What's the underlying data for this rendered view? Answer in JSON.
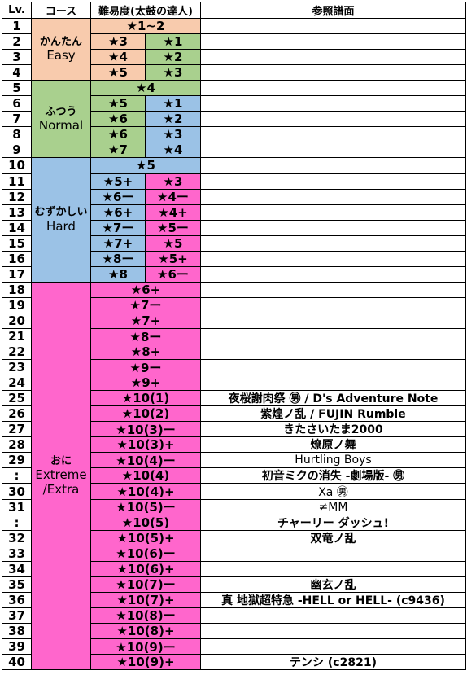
{
  "header": {
    "lv": "Lv.",
    "course": "コース",
    "difficulty": "難易度(太鼓の達人)",
    "reference": "参照譜面"
  },
  "colors": {
    "easy": "#F8CBAD",
    "normal": "#A9D08E",
    "hard": "#9BC2E6",
    "oni": "#FF66CC",
    "white": "#FFFFFF"
  },
  "courses": [
    {
      "jp": "かんたん",
      "en": "Easy",
      "color": "easy"
    },
    {
      "jp": "ふつう",
      "en": "Normal",
      "color": "normal"
    },
    {
      "jp": "むずかしい",
      "en": "Hard",
      "color": "hard"
    },
    {
      "jp": "おに",
      "en": "Extreme\n/Extra",
      "color": "oni"
    }
  ],
  "rows": [
    {
      "lv": "1",
      "full": "★1~2",
      "fc": "easy"
    },
    {
      "lv": "2",
      "left": "★3",
      "lc": "easy",
      "right": "★1",
      "rc": "normal"
    },
    {
      "lv": "3",
      "left": "★4",
      "lc": "easy",
      "right": "★2",
      "rc": "normal"
    },
    {
      "lv": "4",
      "left": "★5",
      "lc": "easy",
      "right": "★3",
      "rc": "normal"
    },
    {
      "lv": "5",
      "full": "★4",
      "fc": "normal"
    },
    {
      "lv": "6",
      "left": "★5",
      "lc": "normal",
      "right": "★1",
      "rc": "hard"
    },
    {
      "lv": "7",
      "left": "★6",
      "lc": "normal",
      "right": "★2",
      "rc": "hard"
    },
    {
      "lv": "8",
      "left": "★6",
      "lc": "normal",
      "right": "★3",
      "rc": "hard"
    },
    {
      "lv": "9",
      "left": "★7",
      "lc": "normal",
      "right": "★4",
      "rc": "hard"
    },
    {
      "lv": "10",
      "full": "★5",
      "fc": "hard"
    },
    {
      "lv": "11",
      "left": "★5+",
      "lc": "hard",
      "right": "★3",
      "rc": "oni"
    },
    {
      "lv": "12",
      "left": "★6ー",
      "lc": "hard",
      "right": "★4ー",
      "rc": "oni"
    },
    {
      "lv": "13",
      "left": "★6+",
      "lc": "hard",
      "right": "★4+",
      "rc": "oni"
    },
    {
      "lv": "14",
      "left": "★7ー",
      "lc": "hard",
      "right": "★5ー",
      "rc": "oni"
    },
    {
      "lv": "15",
      "left": "★7+",
      "lc": "hard",
      "right": "★5",
      "rc": "oni"
    },
    {
      "lv": "16",
      "left": "★8ー",
      "lc": "hard",
      "right": "★5+",
      "rc": "oni"
    },
    {
      "lv": "17",
      "left": "★8",
      "lc": "hard",
      "right": "★6ー",
      "rc": "oni"
    },
    {
      "lv": "18",
      "full": "★6+",
      "fc": "oni"
    },
    {
      "lv": "19",
      "full": "★7ー",
      "fc": "oni"
    },
    {
      "lv": "20",
      "full": "★7+",
      "fc": "oni"
    },
    {
      "lv": "21",
      "full": "★8ー",
      "fc": "oni"
    },
    {
      "lv": "22",
      "full": "★8+",
      "fc": "oni"
    },
    {
      "lv": "23",
      "full": "★9ー",
      "fc": "oni"
    },
    {
      "lv": "24",
      "full": "★9+",
      "fc": "oni"
    },
    {
      "lv": "25",
      "full": "★10(1)",
      "fc": "oni",
      "ref": "夜桜謝肉祭 ㊚ / D's Adventure Note"
    },
    {
      "lv": "26",
      "full": "★10(2)",
      "fc": "oni",
      "ref": "紫煌ノ乱 / FUJIN Rumble"
    },
    {
      "lv": "27",
      "full": "★10(3)ー",
      "fc": "oni",
      "ref": "きたさいたま2000"
    },
    {
      "lv": "28",
      "full": "★10(3)+",
      "fc": "oni",
      "ref": "燎原ノ舞"
    },
    {
      "lv": "29",
      "full": "★10(4)ー",
      "fc": "oni",
      "ref": "Hurtling Boys",
      "plain": true
    },
    {
      "lv": ":",
      "full": "★10(4)",
      "fc": "oni",
      "ref": "初音ミクの消失 -劇場版- ㊚"
    },
    {
      "lv": "30",
      "full": "★10(4)+",
      "fc": "oni",
      "ref": "Xa ㊚",
      "plain": true
    },
    {
      "lv": "31",
      "full": "★10(5)ー",
      "fc": "oni",
      "ref": "≠MM",
      "plain": true
    },
    {
      "lv": ":",
      "full": "★10(5)",
      "fc": "oni",
      "ref": "チャーリー ダッシュ!"
    },
    {
      "lv": "32",
      "full": "★10(5)+",
      "fc": "oni",
      "ref": "双竜ノ乱"
    },
    {
      "lv": "33",
      "full": "★10(6)ー",
      "fc": "oni"
    },
    {
      "lv": "34",
      "full": "★10(6)+",
      "fc": "oni"
    },
    {
      "lv": "35",
      "full": "★10(7)ー",
      "fc": "oni",
      "ref": "幽玄ノ乱"
    },
    {
      "lv": "36",
      "full": "★10(7)+",
      "fc": "oni",
      "ref": "真 地獄超特急 -HELL or HELL- (c9436)"
    },
    {
      "lv": "37",
      "full": "★10(8)ー",
      "fc": "oni"
    },
    {
      "lv": "38",
      "full": "★10(8)+",
      "fc": "oni"
    },
    {
      "lv": "39",
      "full": "★10(9)ー",
      "fc": "oni"
    },
    {
      "lv": "40",
      "full": "★10(9)+",
      "fc": "oni",
      "ref": "テンシ (c2821)"
    }
  ]
}
